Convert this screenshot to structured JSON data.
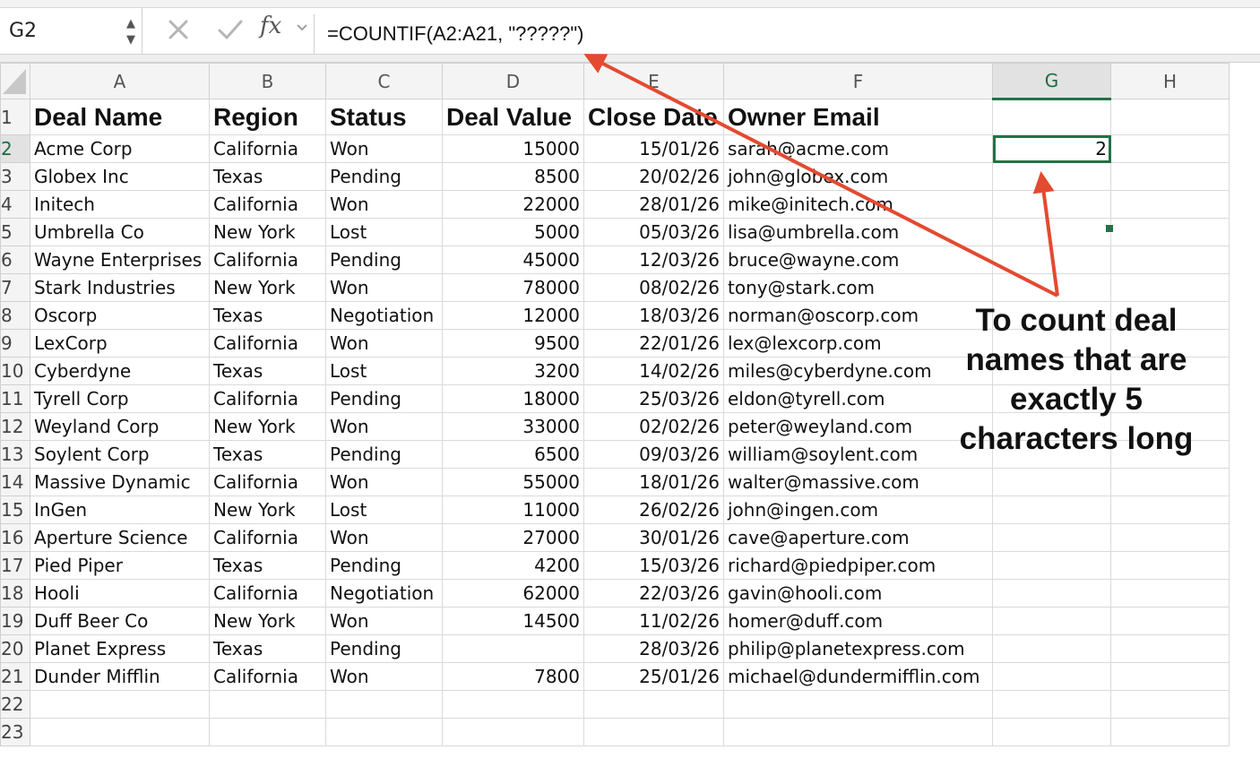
{
  "formula_bar": {
    "name_box": "G2",
    "formula": "=COUNTIF(A2:A21, \"?????\")",
    "fx_label": "fx"
  },
  "columns": [
    "A",
    "B",
    "C",
    "D",
    "E",
    "F",
    "G",
    "H"
  ],
  "headers": {
    "deal_name": "Deal Name",
    "region": "Region",
    "status": "Status",
    "deal_value": "Deal Value",
    "close_date": "Close Date",
    "owner_email": "Owner Email"
  },
  "rows": [
    {
      "row": "2",
      "name": "Acme Corp",
      "region": "California",
      "status": "Won",
      "value": "15000",
      "date": "15/01/26",
      "email": "sarah@acme.com"
    },
    {
      "row": "3",
      "name": "Globex Inc",
      "region": "Texas",
      "status": "Pending",
      "value": "8500",
      "date": "20/02/26",
      "email": "john@globex.com"
    },
    {
      "row": "4",
      "name": "Initech",
      "region": "California",
      "status": "Won",
      "value": "22000",
      "date": "28/01/26",
      "email": "mike@initech.com"
    },
    {
      "row": "5",
      "name": "Umbrella Co",
      "region": "New York",
      "status": "Lost",
      "value": "5000",
      "date": "05/03/26",
      "email": "lisa@umbrella.com"
    },
    {
      "row": "6",
      "name": "Wayne Enterprises",
      "region": "California",
      "status": "Pending",
      "value": "45000",
      "date": "12/03/26",
      "email": "bruce@wayne.com"
    },
    {
      "row": "7",
      "name": "Stark Industries",
      "region": "New York",
      "status": "Won",
      "value": "78000",
      "date": "08/02/26",
      "email": "tony@stark.com"
    },
    {
      "row": "8",
      "name": "Oscorp",
      "region": "Texas",
      "status": "Negotiation",
      "value": "12000",
      "date": "18/03/26",
      "email": "norman@oscorp.com"
    },
    {
      "row": "9",
      "name": "LexCorp",
      "region": "California",
      "status": "Won",
      "value": "9500",
      "date": "22/01/26",
      "email": "lex@lexcorp.com"
    },
    {
      "row": "10",
      "name": "Cyberdyne",
      "region": "Texas",
      "status": "Lost",
      "value": "3200",
      "date": "14/02/26",
      "email": "miles@cyberdyne.com"
    },
    {
      "row": "11",
      "name": "Tyrell Corp",
      "region": "California",
      "status": "Pending",
      "value": "18000",
      "date": "25/03/26",
      "email": "eldon@tyrell.com"
    },
    {
      "row": "12",
      "name": "Weyland Corp",
      "region": "New York",
      "status": "Won",
      "value": "33000",
      "date": "02/02/26",
      "email": "peter@weyland.com"
    },
    {
      "row": "13",
      "name": "Soylent Corp",
      "region": "Texas",
      "status": "Pending",
      "value": "6500",
      "date": "09/03/26",
      "email": "william@soylent.com"
    },
    {
      "row": "14",
      "name": "Massive Dynamic",
      "region": "California",
      "status": "Won",
      "value": "55000",
      "date": "18/01/26",
      "email": "walter@massive.com"
    },
    {
      "row": "15",
      "name": "InGen",
      "region": "New York",
      "status": "Lost",
      "value": "11000",
      "date": "26/02/26",
      "email": "john@ingen.com"
    },
    {
      "row": "16",
      "name": "Aperture Science",
      "region": "California",
      "status": "Won",
      "value": "27000",
      "date": "30/01/26",
      "email": "cave@aperture.com"
    },
    {
      "row": "17",
      "name": "Pied Piper",
      "region": "Texas",
      "status": "Pending",
      "value": "4200",
      "date": "15/03/26",
      "email": "richard@piedpiper.com"
    },
    {
      "row": "18",
      "name": "Hooli",
      "region": "California",
      "status": "Negotiation",
      "value": "62000",
      "date": "22/03/26",
      "email": "gavin@hooli.com"
    },
    {
      "row": "19",
      "name": "Duff Beer Co",
      "region": "New York",
      "status": "Won",
      "value": "14500",
      "date": "11/02/26",
      "email": "homer@duff.com"
    },
    {
      "row": "20",
      "name": "Planet Express",
      "region": "Texas",
      "status": "Pending",
      "value": "",
      "date": "28/03/26",
      "email": "philip@planetexpress.com"
    },
    {
      "row": "21",
      "name": "Dunder Mifflin",
      "region": "California",
      "status": "Won",
      "value": "7800",
      "date": "25/01/26",
      "email": "michael@dundermifflin.com"
    }
  ],
  "empty_rows": [
    "22",
    "23"
  ],
  "header_row_number": "1",
  "result_cell": {
    "ref": "G2",
    "value": "2"
  },
  "annotation": {
    "text_lines": [
      "To count deal",
      "names that are",
      "exactly 5",
      "characters long"
    ],
    "arrow_color": "#e34a30"
  },
  "colors": {
    "selection_green": "#217346"
  }
}
